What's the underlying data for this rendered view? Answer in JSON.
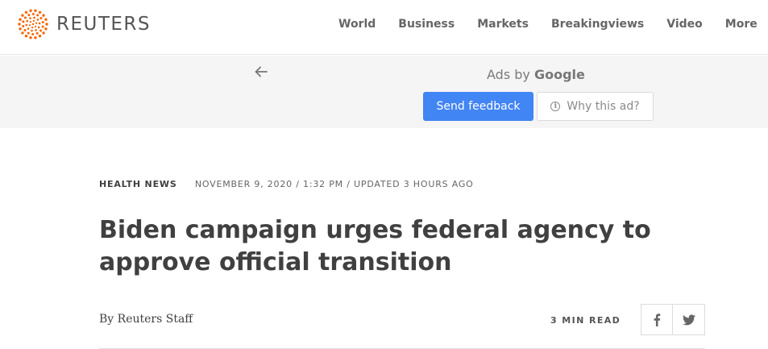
{
  "header": {
    "brand": "REUTERS",
    "nav": [
      {
        "label": "World"
      },
      {
        "label": "Business"
      },
      {
        "label": "Markets"
      },
      {
        "label": "Breakingviews"
      },
      {
        "label": "Video"
      },
      {
        "label": "More"
      }
    ]
  },
  "ad": {
    "ads_by": "Ads by",
    "google": "Google",
    "send_feedback": "Send feedback",
    "why_this_ad": "Why this ad?",
    "info_glyph": "i"
  },
  "article": {
    "section": "HEALTH NEWS",
    "dateline": "NOVEMBER 9, 2020 / 1:32 PM / UPDATED 3 HOURS AGO",
    "headline": "Biden campaign urges federal agency to approve official transition",
    "byline_prefix": "By",
    "author": "Reuters Staff",
    "read_time": "3 MIN READ"
  },
  "colors": {
    "brand_orange": "#fa6400",
    "google_blue": "#4285f4",
    "text_dark": "#404040"
  },
  "icons": {
    "logo": "reuters-dot-sphere-icon",
    "back": "arrow-left-icon",
    "info": "info-circle-icon",
    "facebook": "facebook-icon",
    "twitter": "twitter-icon"
  }
}
